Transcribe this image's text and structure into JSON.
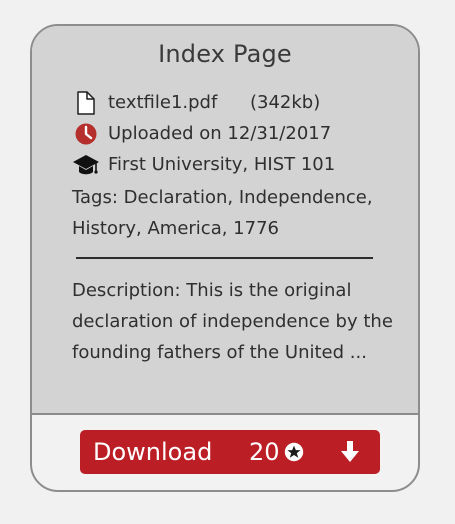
{
  "card": {
    "title": "Index Page",
    "file": {
      "name": "textfile1.pdf",
      "size": "(342kb)",
      "icon": "file-icon"
    },
    "uploaded": {
      "text": "Uploaded on 12/31/2017",
      "icon": "clock-icon"
    },
    "course": {
      "text": "First University, HIST 101",
      "icon": "graduation-cap-icon"
    },
    "tags": "Tags: Declaration, Independence, History, America, 1776",
    "description": "Description: This is the original declaration of independence by the founding fathers of the United ..."
  },
  "download": {
    "label": "Download",
    "count": "20",
    "star_icon": "star-icon",
    "arrow_icon": "download-arrow-icon",
    "color": "#bb1e24"
  },
  "colors": {
    "card_top": "#d3d3d3",
    "card_bottom": "#f2f2f2",
    "text": "#2f2f2f",
    "clock_red": "#b5302d"
  }
}
